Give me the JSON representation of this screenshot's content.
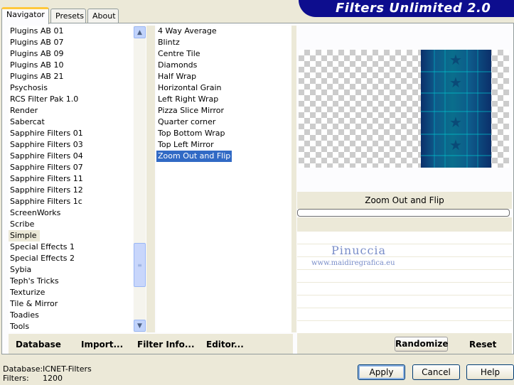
{
  "tabs": [
    {
      "label": "Navigator"
    },
    {
      "label": "Presets"
    },
    {
      "label": "About"
    }
  ],
  "banner": {
    "title": "Filters Unlimited 2.0",
    "bg_color": "#0d0d8e"
  },
  "categories": {
    "selected_index": 18,
    "items": [
      "Plugins AB 01",
      "Plugins AB 07",
      "Plugins AB 09",
      "Plugins AB 10",
      "Plugins AB 21",
      "Psychosis",
      "RCS Filter Pak 1.0",
      "Render",
      "Sabercat",
      "Sapphire Filters 01",
      "Sapphire Filters 03",
      "Sapphire Filters 04",
      "Sapphire Filters 07",
      "Sapphire Filters 11",
      "Sapphire Filters 12",
      "Sapphire Filters 1c",
      "ScreenWorks",
      "Scribe",
      "Simple",
      "Special Effects 1",
      "Special Effects 2",
      "Sybia",
      "Teph's Tricks",
      "Texturize",
      "Tile & Mirror",
      "Toadies",
      "Tools"
    ]
  },
  "filters": {
    "selected_index": 11,
    "items": [
      "4 Way Average",
      "Blintz",
      "Centre Tile",
      "Diamonds",
      "Half Wrap",
      "Horizontal Grain",
      "Left Right Wrap",
      "Pizza Slice Mirror",
      "Quarter corner",
      "Top Bottom Wrap",
      "Top Left Mirror",
      "Zoom Out and Flip"
    ]
  },
  "main_buttons": {
    "database": "Database",
    "import": "Import...",
    "filter_info": "Filter Info...",
    "editor": "Editor..."
  },
  "preview": {
    "filter_name": "Zoom Out and Flip",
    "watermark_name": "Pinuccia",
    "watermark_url": "www.maidiregrafica.eu"
  },
  "right_buttons": {
    "randomize": "Randomize",
    "reset": "Reset"
  },
  "footer": {
    "database_label": "Database:",
    "database_value": "ICNET-Filters",
    "filters_label": "Filters:",
    "filters_value": "1200"
  },
  "dialog_buttons": {
    "apply": "Apply",
    "cancel": "Cancel",
    "help": "Help"
  },
  "colors": {
    "selection": "#316ac5",
    "window_bg": "#ece9d8"
  }
}
